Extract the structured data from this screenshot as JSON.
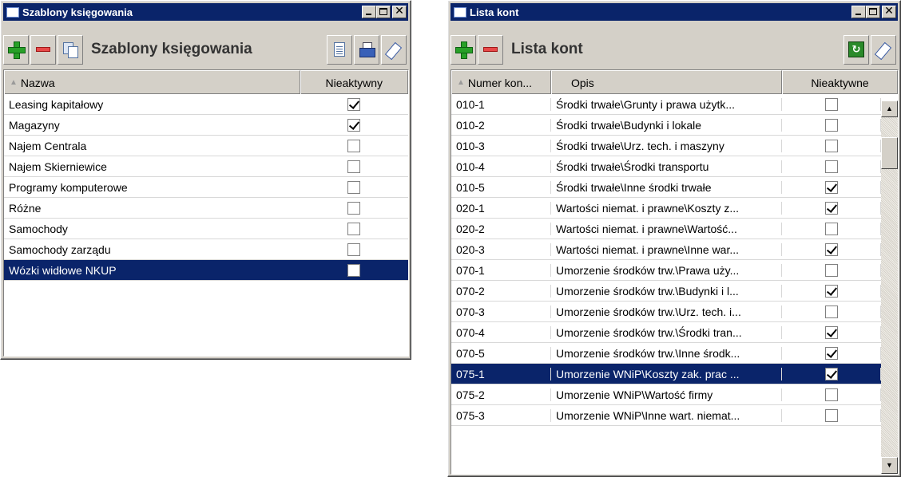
{
  "win1": {
    "title": "Szablony księgowania",
    "toolbar_title": "Szablony księgowania",
    "columns": [
      "Nazwa",
      "Nieaktywny"
    ],
    "rows": [
      {
        "name": "Leasing kapitałowy",
        "inactive": true
      },
      {
        "name": "Magazyny",
        "inactive": true
      },
      {
        "name": "Najem Centrala",
        "inactive": false
      },
      {
        "name": "Najem Skierniewice",
        "inactive": false
      },
      {
        "name": "Programy komputerowe",
        "inactive": false
      },
      {
        "name": "Różne",
        "inactive": false
      },
      {
        "name": "Samochody",
        "inactive": false
      },
      {
        "name": "Samochody zarządu",
        "inactive": false
      },
      {
        "name": "Wózki widłowe NKUP",
        "inactive": false,
        "selected": true
      }
    ]
  },
  "win2": {
    "title": "Lista kont",
    "toolbar_title": "Lista kont",
    "columns": [
      "Numer kon...",
      "Opis",
      "Nieaktywne"
    ],
    "rows": [
      {
        "num": "010-1",
        "desc": "Środki trwałe\\Grunty i prawa użytk...",
        "inactive": false
      },
      {
        "num": "010-2",
        "desc": "Środki trwałe\\Budynki i lokale",
        "inactive": false
      },
      {
        "num": "010-3",
        "desc": "Środki trwałe\\Urz. tech. i maszyny",
        "inactive": false
      },
      {
        "num": "010-4",
        "desc": "Środki trwałe\\Środki transportu",
        "inactive": false
      },
      {
        "num": "010-5",
        "desc": "Środki trwałe\\Inne środki trwałe",
        "inactive": true
      },
      {
        "num": "020-1",
        "desc": "Wartości niemat. i prawne\\Koszty z...",
        "inactive": true
      },
      {
        "num": "020-2",
        "desc": "Wartości niemat. i prawne\\Wartość...",
        "inactive": false
      },
      {
        "num": "020-3",
        "desc": "Wartości niemat. i prawne\\Inne war...",
        "inactive": true
      },
      {
        "num": "070-1",
        "desc": "Umorzenie środków trw.\\Prawa uży...",
        "inactive": false
      },
      {
        "num": "070-2",
        "desc": "Umorzenie środków trw.\\Budynki i l...",
        "inactive": true
      },
      {
        "num": "070-3",
        "desc": "Umorzenie środków trw.\\Urz. tech. i...",
        "inactive": false
      },
      {
        "num": "070-4",
        "desc": "Umorzenie środków trw.\\Środki tran...",
        "inactive": true
      },
      {
        "num": "070-5",
        "desc": "Umorzenie środków trw.\\Inne środk...",
        "inactive": true
      },
      {
        "num": "075-1",
        "desc": "Umorzenie WNiP\\Koszty zak. prac ...",
        "inactive": true,
        "selected": true
      },
      {
        "num": "075-2",
        "desc": "Umorzenie WNiP\\Wartość firmy",
        "inactive": false
      },
      {
        "num": "075-3",
        "desc": "Umorzenie WNiP\\Inne wart. niemat...",
        "inactive": false
      }
    ]
  },
  "icons": {
    "add": "plus-icon",
    "remove": "minus-icon",
    "copy": "copy-icon",
    "document": "document-icon",
    "print": "printer-icon",
    "edit": "eraser-icon",
    "refresh": "refresh-icon"
  },
  "colors": {
    "titlebar": "#0a246a",
    "selection": "#0a246a",
    "face": "#d4d0c8"
  }
}
